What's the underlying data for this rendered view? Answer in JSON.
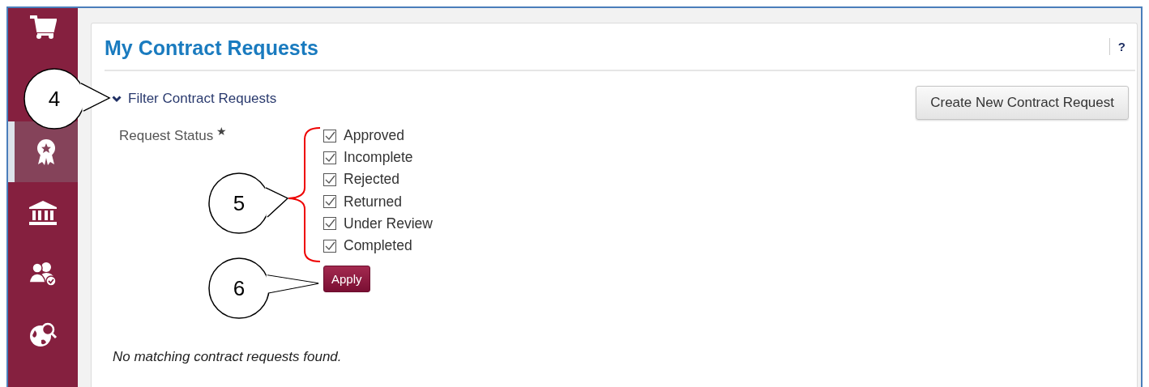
{
  "sidebar": {
    "items": [
      {
        "kind": "cart",
        "selected": false
      },
      {
        "kind": "award",
        "selected": true
      },
      {
        "kind": "bank",
        "selected": false
      },
      {
        "kind": "users",
        "selected": false
      },
      {
        "kind": "globe",
        "selected": false
      }
    ]
  },
  "panel": {
    "title": "My Contract Requests",
    "help": "?",
    "filter": {
      "label": "Filter Contract Requests",
      "expanded": true
    },
    "create_button": "Create New Contract Request",
    "status_label": "Request Status",
    "required_mark": "★",
    "statuses": [
      {
        "label": "Approved",
        "checked": true
      },
      {
        "label": "Incomplete",
        "checked": true
      },
      {
        "label": "Rejected",
        "checked": true
      },
      {
        "label": "Returned",
        "checked": true
      },
      {
        "label": "Under Review",
        "checked": true
      },
      {
        "label": "Completed",
        "checked": true
      }
    ],
    "apply_button": "Apply",
    "message": "No matching contract requests found."
  },
  "callouts": [
    {
      "label": "4"
    },
    {
      "label": "5"
    },
    {
      "label": "6"
    }
  ]
}
